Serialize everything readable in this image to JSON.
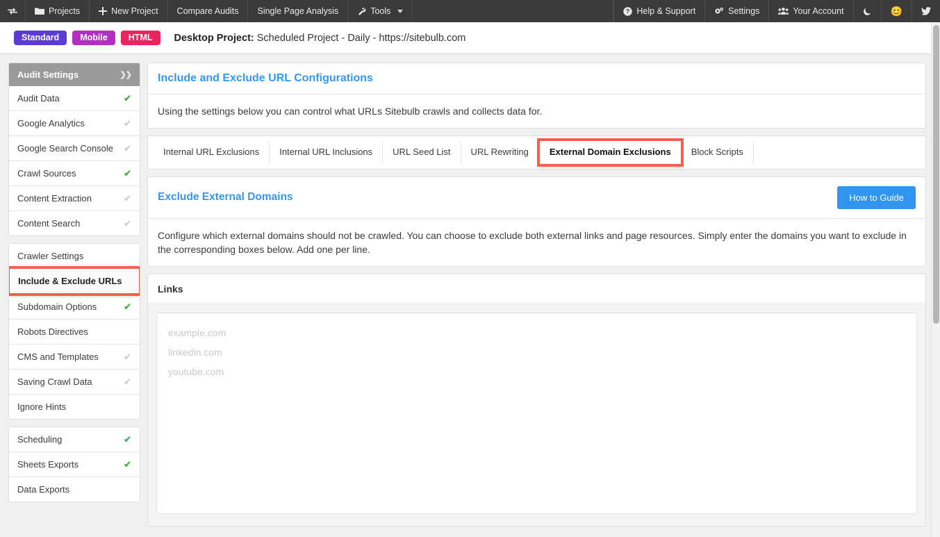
{
  "navbar": {
    "swap_icon": "exchange-arrows-icon",
    "left_items": [
      {
        "label": "Projects",
        "icon": "folder-icon"
      },
      {
        "label": "New Project",
        "icon": "plus-icon"
      },
      {
        "label": "Compare Audits",
        "icon": ""
      },
      {
        "label": "Single Page Analysis",
        "icon": ""
      },
      {
        "label": "Tools",
        "icon": "wrench-icon",
        "caret": true
      }
    ],
    "right_items": [
      {
        "label": "Help & Support",
        "icon": "question-circle-icon"
      },
      {
        "label": "Settings",
        "icon": "gears-icon"
      },
      {
        "label": "Your Account",
        "icon": "users-icon"
      }
    ],
    "dark_mode_icon": "moon-icon",
    "emoji_icon": "smiley-icon",
    "twitter_icon": "twitter-bird-icon"
  },
  "project_header": {
    "badges": [
      {
        "label": "Standard",
        "color": "#5b3bd4"
      },
      {
        "label": "Mobile",
        "color": "#b32fc0"
      },
      {
        "label": "HTML",
        "color": "#e8245f"
      }
    ],
    "title_label": "Desktop Project:",
    "title_value": "Scheduled Project - Daily - https://sitebulb.com"
  },
  "sidebar": {
    "header": {
      "label": "Audit Settings",
      "chevron_icon": "double-chevron-down-icon"
    },
    "group1": [
      {
        "label": "Audit Data",
        "check": "on"
      },
      {
        "label": "Google Analytics",
        "check": "off"
      },
      {
        "label": "Google Search Console",
        "check": "off"
      },
      {
        "label": "Crawl Sources",
        "check": "on"
      },
      {
        "label": "Content Extraction",
        "check": "off"
      },
      {
        "label": "Content Search",
        "check": "off"
      }
    ],
    "group2": [
      {
        "label": "Crawler Settings",
        "check": "none",
        "highlighted": false
      },
      {
        "label": "Include & Exclude URLs",
        "check": "none",
        "highlighted": true
      },
      {
        "label": "Subdomain Options",
        "check": "on",
        "highlighted": false
      },
      {
        "label": "Robots Directives",
        "check": "none",
        "highlighted": false
      },
      {
        "label": "CMS and Templates",
        "check": "off",
        "highlighted": false
      },
      {
        "label": "Saving Crawl Data",
        "check": "off",
        "highlighted": false
      },
      {
        "label": "Ignore Hints",
        "check": "none",
        "highlighted": false
      }
    ],
    "group3": [
      {
        "label": "Scheduling",
        "check": "on"
      },
      {
        "label": "Sheets Exports",
        "check": "on"
      },
      {
        "label": "Data Exports",
        "check": "none"
      }
    ]
  },
  "main": {
    "intro_panel": {
      "title": "Include and Exclude URL Configurations",
      "body": "Using the settings below you can control what URLs Sitebulb crawls and collects data for."
    },
    "tabs": [
      {
        "label": "Internal URL Exclusions",
        "highlighted": false
      },
      {
        "label": "Internal URL Inclusions",
        "highlighted": false
      },
      {
        "label": "URL Seed List",
        "highlighted": false
      },
      {
        "label": "URL Rewriting",
        "highlighted": false
      },
      {
        "label": "External Domain Exclusions",
        "highlighted": true
      },
      {
        "label": "Block Scripts",
        "highlighted": false
      }
    ],
    "exclude_panel": {
      "title": "Exclude External Domains",
      "guide_button": "How to Guide",
      "body": "Configure which external domains should not be crawled. You can choose to exclude both external links and page resources. Simply enter the domains you want to exclude in the corresponding boxes below. Add one per line."
    },
    "links_panel": {
      "title": "Links",
      "textarea_placeholder": "example.com\nlinkedin.com\nyoutube.com",
      "textarea_value": ""
    }
  },
  "colors": {
    "accent_blue": "#3498f0",
    "highlight_red": "#f4604a",
    "check_green": "#4caf50",
    "navbar_dark": "#3a3a3a"
  }
}
